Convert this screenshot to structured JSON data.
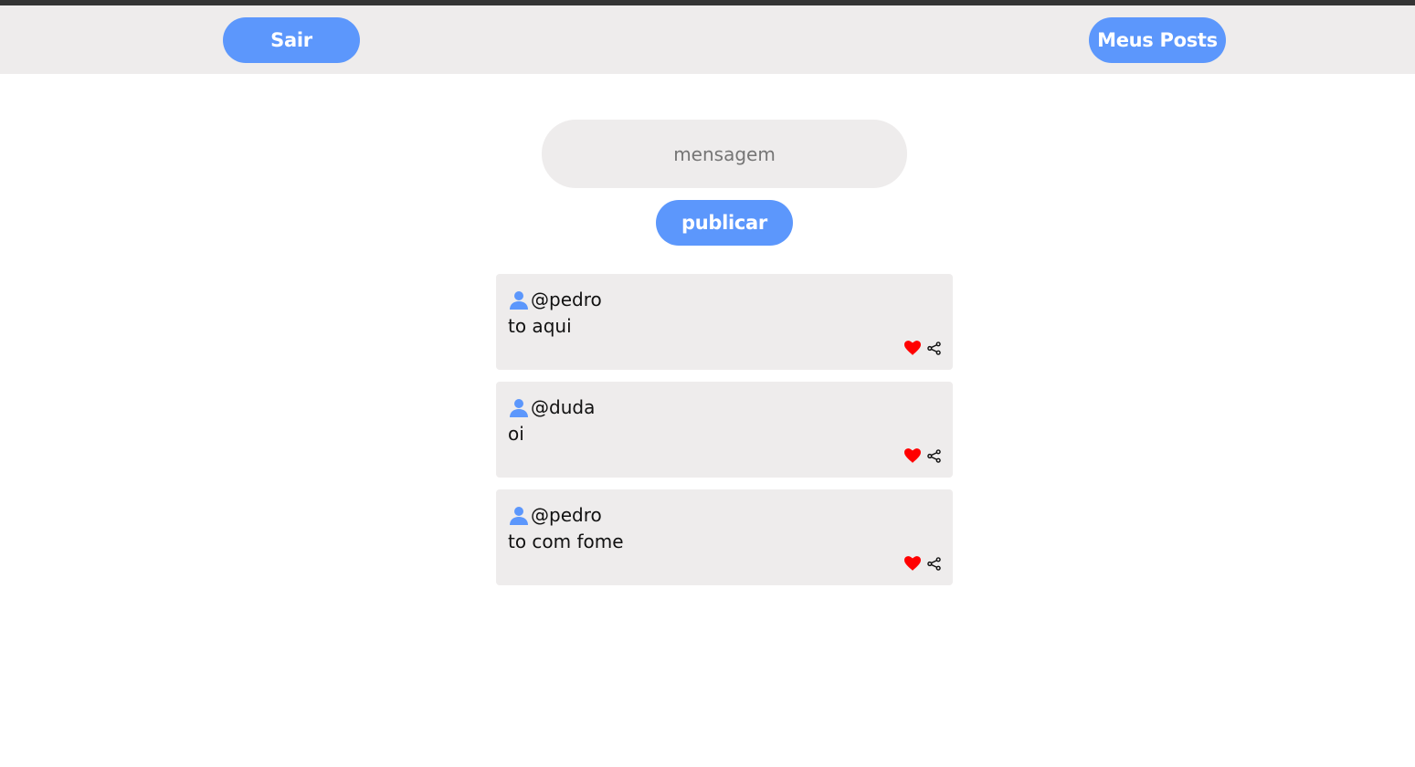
{
  "header": {
    "logout_label": "Sair",
    "my_posts_label": "Meus Posts"
  },
  "composer": {
    "placeholder": "mensagem",
    "value": "",
    "publish_label": "publicar"
  },
  "posts": [
    {
      "username": "@pedro",
      "text": "to aqui"
    },
    {
      "username": "@duda",
      "text": "oi"
    },
    {
      "username": "@pedro",
      "text": "to com fome"
    }
  ],
  "icons": {
    "user": "user-icon",
    "like": "heart-icon",
    "share": "share-icon"
  },
  "colors": {
    "accent": "#5c97fc",
    "surface": "#eeecec",
    "like": "#ff0000",
    "top_strip": "#343434"
  }
}
